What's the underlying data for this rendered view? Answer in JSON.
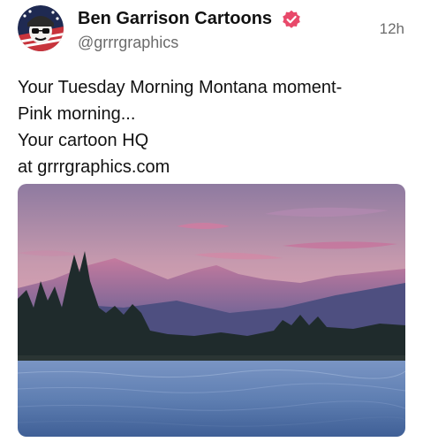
{
  "post": {
    "author_name": "Ben Garrison Cartoons",
    "author_handle": "@grrrgraphics",
    "timestamp": "12h",
    "text_lines": [
      "Your Tuesday Morning Montana moment-",
      "Pink morning...",
      "Your cartoon HQ",
      "at grrrgraphics.com"
    ],
    "verified_badge_color": "#e8496a",
    "avatar_icon": "cartoon-man-avatar",
    "image_subject": "mountain-lake-sunrise-photo"
  },
  "colors": {
    "text": "#111111",
    "muted": "#6b6b6b",
    "sky_top": "#9a7fa0",
    "sky_pink": "#e8a6b4",
    "water": "#5d7fb0"
  }
}
